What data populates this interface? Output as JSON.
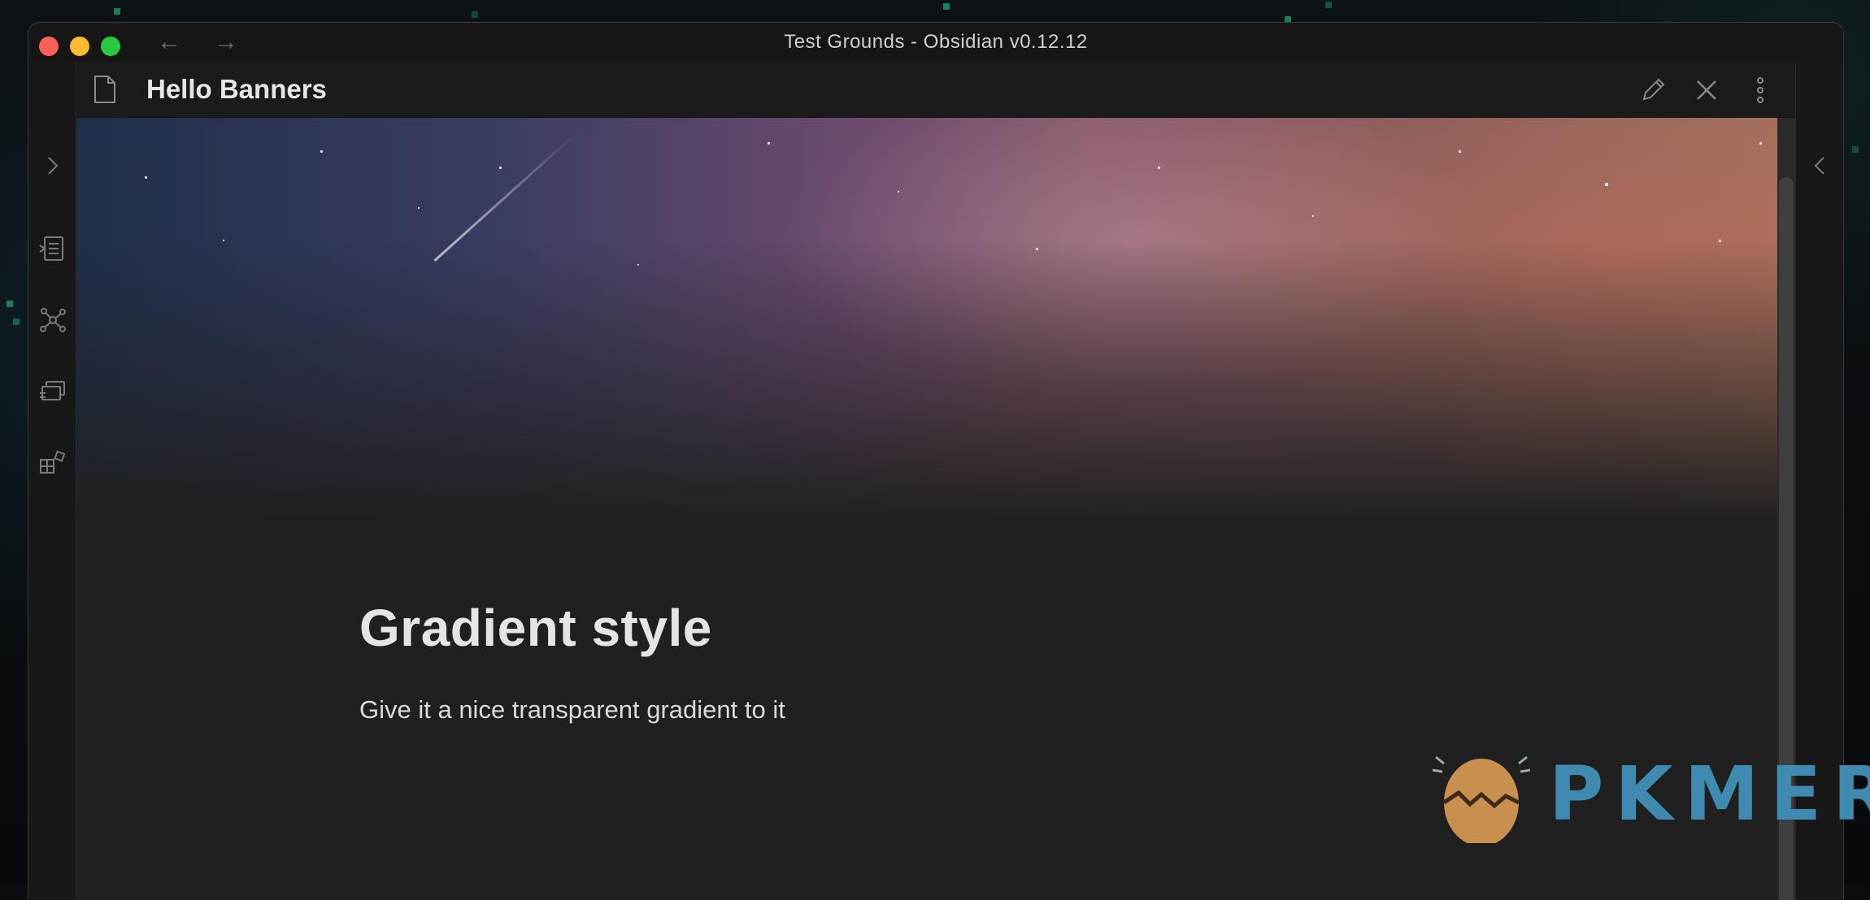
{
  "window": {
    "title": "Test Grounds - Obsidian v0.12.12",
    "nav_back": "←",
    "nav_forward": "→"
  },
  "ribbon": {
    "collapse_left": "›",
    "icons": [
      "open-note-icon",
      "graph-view-icon",
      "slides-icon",
      "plugins-icon"
    ]
  },
  "right_rail": {
    "collapse_right": "‹"
  },
  "view_header": {
    "title": "Hello Banners",
    "actions": [
      "edit-icon",
      "close-icon",
      "more-options-icon"
    ]
  },
  "note": {
    "heading": "Gradient style",
    "paragraph": "Give it a nice transparent gradient to it"
  },
  "watermark": {
    "text": "PKMER"
  },
  "colors": {
    "background": "#202020",
    "text": "#e4e4e4",
    "traffic_red": "#fe5f57",
    "traffic_yellow": "#febc2e",
    "traffic_green": "#28c840",
    "logo_blue": "#3f8bb0",
    "logo_egg": "#c98f4e"
  }
}
